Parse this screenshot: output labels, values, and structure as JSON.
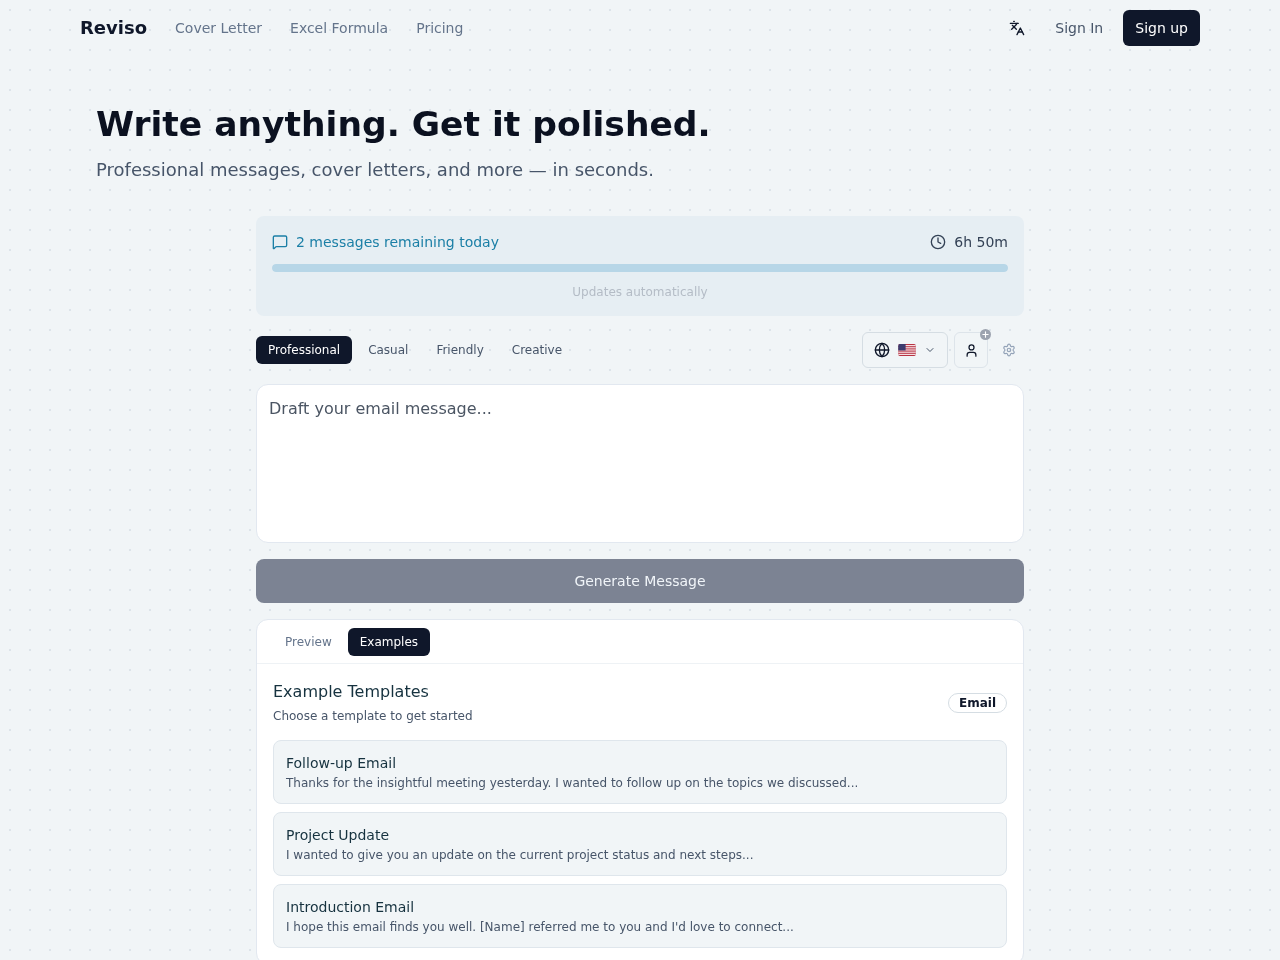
{
  "nav": {
    "logo": "Reviso",
    "links": [
      "Cover Letter",
      "Excel Formula",
      "Pricing"
    ],
    "sign_in": "Sign In",
    "sign_up": "Sign up"
  },
  "hero": {
    "title": "Write anything. Get it polished.",
    "subtitle": "Professional messages, cover letters, and more — in seconds."
  },
  "usage": {
    "message": "2 messages remaining today",
    "timer": "6h 50m",
    "level": 1,
    "note": "Updates automatically"
  },
  "tones": [
    {
      "label": "Professional",
      "selected": true
    },
    {
      "label": "Casual",
      "selected": false
    },
    {
      "label": "Friendly",
      "selected": false
    },
    {
      "label": "Creative",
      "selected": false
    }
  ],
  "editor": {
    "placeholder": "Draft your email message..."
  },
  "generate_button": {
    "label": "Generate Message",
    "disabled": true
  },
  "output_tabs": [
    {
      "label": "Preview",
      "selected": false
    },
    {
      "label": "Examples",
      "selected": true
    }
  ],
  "examples": {
    "title": "Example Templates",
    "subtitle": "Choose a template to get started",
    "badge": "Email",
    "templates": [
      {
        "title": "Follow-up Email",
        "preview": "Thanks for the insightful meeting yesterday. I wanted to follow up on the topics we discussed..."
      },
      {
        "title": "Project Update",
        "preview": "I wanted to give you an update on the current project status and next steps..."
      },
      {
        "title": "Introduction Email",
        "preview": "I hope this email finds you well. [Name] referred me to you and I'd love to connect..."
      }
    ]
  }
}
